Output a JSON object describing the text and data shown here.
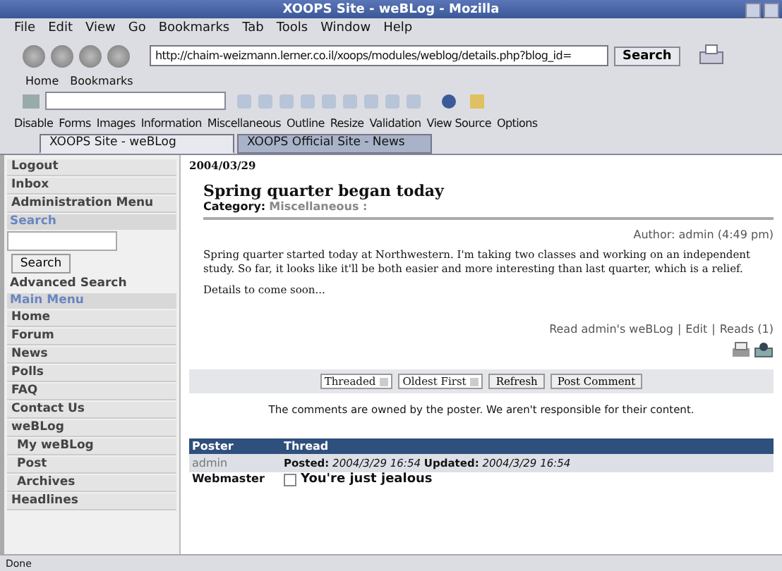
{
  "window": {
    "title": "XOOPS Site - weBLog - Mozilla"
  },
  "menu": [
    "File",
    "Edit",
    "View",
    "Go",
    "Bookmarks",
    "Tab",
    "Tools",
    "Window",
    "Help"
  ],
  "navigation": {
    "url": "http://chaim-weizmann.lerner.co.il/xoops/modules/weblog/details.php?blog_id=",
    "search_button": "Search"
  },
  "bookmarks_bar": [
    "Home",
    "Bookmarks"
  ],
  "developer_toolbar": [
    "Disable",
    "Forms",
    "Images",
    "Information",
    "Miscellaneous",
    "Outline",
    "Resize",
    "Validation",
    "View Source",
    "Options"
  ],
  "tabs": [
    {
      "label": "XOOPS Site - weBLog",
      "selected": true
    },
    {
      "label": "XOOPS Official Site - News",
      "selected": false
    }
  ],
  "sidebar": {
    "user_menu": [
      "Logout",
      "Inbox",
      "Administration Menu"
    ],
    "search_heading": "Search",
    "search_button": "Search",
    "advanced_search": "Advanced Search",
    "main_menu_heading": "Main Menu",
    "main_menu": [
      {
        "label": "Home"
      },
      {
        "label": "Forum"
      },
      {
        "label": "News"
      },
      {
        "label": "Polls"
      },
      {
        "label": "FAQ"
      },
      {
        "label": "Contact Us"
      },
      {
        "label": "weBLog",
        "children": [
          {
            "label": "My weBLog"
          },
          {
            "label": "Post"
          },
          {
            "label": "Archives"
          }
        ]
      },
      {
        "label": "Headlines"
      }
    ]
  },
  "entry": {
    "date": "2004/03/29",
    "title": "Spring quarter began today",
    "category_label": "Category:",
    "category": "Miscellaneous :",
    "author": "Author: admin (4:49 pm)",
    "body": "Spring quarter started today at Northwestern. I'm taking two classes and working on an independent study. So far, it looks like it'll be both easier and more interesting than last quarter, which is a relief.",
    "details": "Details to come soon...",
    "links": [
      "Read admin's weBLog",
      "Edit",
      "Reads (1)"
    ],
    "link_separator": "|"
  },
  "comment_controls": {
    "mode": "Threaded",
    "order": "Oldest First",
    "buttons": [
      "Refresh",
      "Post Comment"
    ]
  },
  "notice": "The comments are owned by the poster. We aren't responsible for their content.",
  "comments_table": {
    "columns": [
      "Poster",
      "Thread"
    ],
    "rows": [
      {
        "poster": "admin",
        "thread": "**Posted:** *2004/3/29 16:54* **Updated:** *2004/3/29 16:54*",
        "kind": "meta"
      },
      {
        "poster": "Webmaster",
        "thread": "You're just jealous",
        "kind": "title"
      }
    ]
  },
  "status_bar": {
    "text": "Done"
  }
}
